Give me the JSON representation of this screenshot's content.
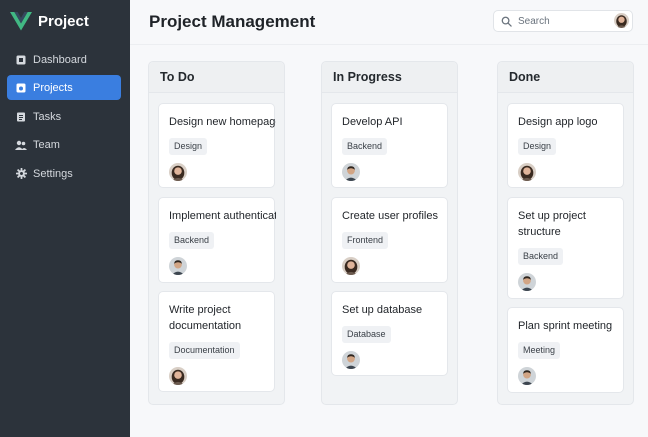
{
  "app": {
    "name": "Project",
    "logo_color": "#41b883",
    "logo_dark": "#35495e"
  },
  "sidebar": {
    "items": [
      {
        "label": "Dashboard",
        "icon": "dashboard-icon",
        "active": false
      },
      {
        "label": "Projects",
        "icon": "projects-icon",
        "active": true
      },
      {
        "label": "Tasks",
        "icon": "tasks-icon",
        "active": false
      },
      {
        "label": "Team",
        "icon": "team-icon",
        "active": false
      },
      {
        "label": "Settings",
        "icon": "gear-icon",
        "active": false
      }
    ]
  },
  "header": {
    "title": "Project Management",
    "search_placeholder": "Search"
  },
  "colors": {
    "accent": "#3a7ee0",
    "sidebar_bg": "#2c333b"
  },
  "board": {
    "columns": [
      {
        "title": "To Do",
        "cards": [
          {
            "title": "Design new homepage",
            "tag": "Design",
            "avatar": "woman"
          },
          {
            "title": "Implement authentication",
            "tag": "Backend",
            "avatar": "man"
          },
          {
            "title": "Write project documentation",
            "tag": "Documentation",
            "avatar": "woman"
          }
        ]
      },
      {
        "title": "In Progress",
        "cards": [
          {
            "title": "Develop API",
            "tag": "Backend",
            "avatar": "man"
          },
          {
            "title": "Create user profiles",
            "tag": "Frontend",
            "avatar": "woman"
          },
          {
            "title": "Set up database",
            "tag": "Database",
            "avatar": "man"
          }
        ]
      },
      {
        "title": "Done",
        "cards": [
          {
            "title": "Design app logo",
            "tag": "Design",
            "avatar": "woman"
          },
          {
            "title": "Set up project structure",
            "tag": "Backend",
            "avatar": "man"
          },
          {
            "title": "Plan sprint meeting",
            "tag": "Meeting",
            "avatar": "man"
          }
        ]
      }
    ]
  }
}
